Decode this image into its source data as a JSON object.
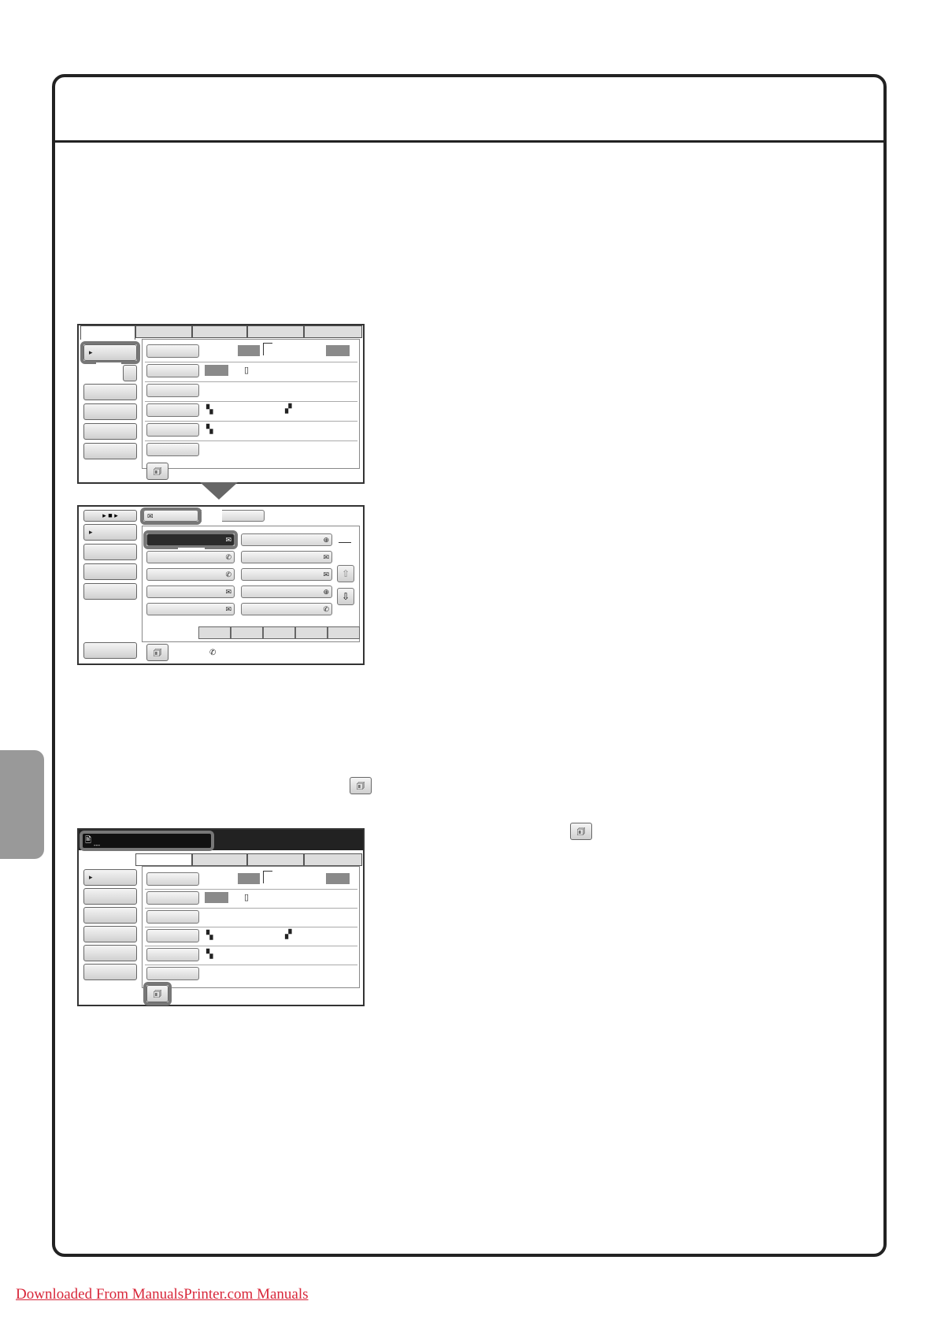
{
  "footer": {
    "link_text": "Downloaded From ManualsPrinter.com Manuals"
  },
  "icons": {
    "arrow_right": "▸",
    "program": "🗊",
    "paper": "▯",
    "mode": "▚",
    "ratio": "▞",
    "mail": "✉",
    "phone": "✆",
    "globe": "⊕",
    "up": "⇧",
    "down": "⇩",
    "doc": "🖹",
    "dash": "---"
  },
  "colors": {
    "frame": "#222222",
    "side_tab": "#999999",
    "link": "#d8273a"
  }
}
